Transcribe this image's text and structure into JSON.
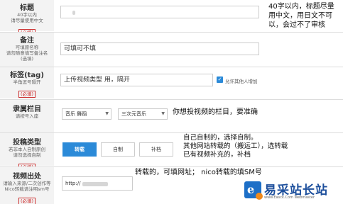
{
  "title_field": {
    "label": "标题",
    "hint": "40字以内\n请尽量使用中文",
    "required": "(必填)",
    "annotation": "40字以内，标题尽量\n用中文，用日文不可\n以，会过不了审核"
  },
  "remark_field": {
    "label": "备注",
    "hint": "可填原名称\n请勿随意填写备注名\n(选填)",
    "value": "可填可不填"
  },
  "tag_field": {
    "label": "标签(tag)",
    "hint": "半角逗号隔开",
    "required": "(必填)",
    "value": "上传视频类型 用，隔开",
    "allow_others_label": "允许其他人增加",
    "allow_others_checked": true
  },
  "category_field": {
    "label": "隶属栏目",
    "hint": "请按号入座",
    "select1": "音乐 舞蹈",
    "select2": "三次元音乐",
    "annotation": "你想投视频的栏目，要准确"
  },
  "type_field": {
    "label": "投稿类型",
    "hint": "若非本人自制原创\n请勿选择自制",
    "required": "(必填)",
    "buttons": [
      "转载",
      "自制",
      "补档"
    ],
    "active_index": 0,
    "annotation": "自己自制的，选择自制。\n其他网站转载的（搬运工），选转载\n已有视频补充的，补档"
  },
  "source_field": {
    "label": "视频出处",
    "hint": "请输入来源/二次创作等\nNico转载请注明sm号",
    "required": "(必填)",
    "value": "http://",
    "annotation": "转载的，可填网址； nico转载的填SM号"
  },
  "watermark": {
    "name": "易采站长站",
    "url": "www.Easck.Com  Webmaster"
  }
}
